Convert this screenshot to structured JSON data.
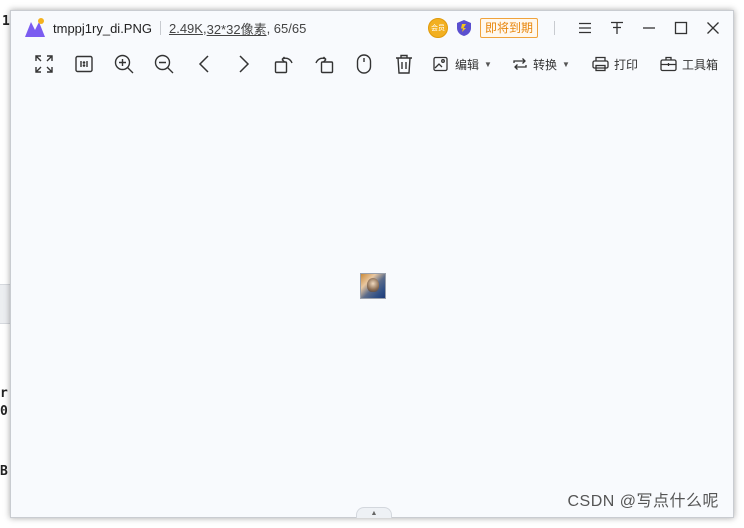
{
  "background": {
    "chars": [
      "1",
      "r",
      "0",
      "B"
    ]
  },
  "viewer": {
    "title": {
      "filename": "tmppj1ry_di.PNG",
      "file_size": "2.49K",
      "comma1": " ,",
      "dimensions": "32*32像素",
      "position": " , 65/65",
      "vip_text": "会员",
      "expire_label": "即将到期"
    },
    "toolbar": {
      "edit_label": "编辑",
      "convert_label": "转换",
      "print_label": "打印",
      "toolbox_label": "工具箱",
      "caret": "▼"
    },
    "collapse_glyph": "▲"
  },
  "watermark": "CSDN @写点什么呢",
  "colors": {
    "accent_orange": "#e8860c",
    "viewer_bg": "#f8fafd"
  }
}
